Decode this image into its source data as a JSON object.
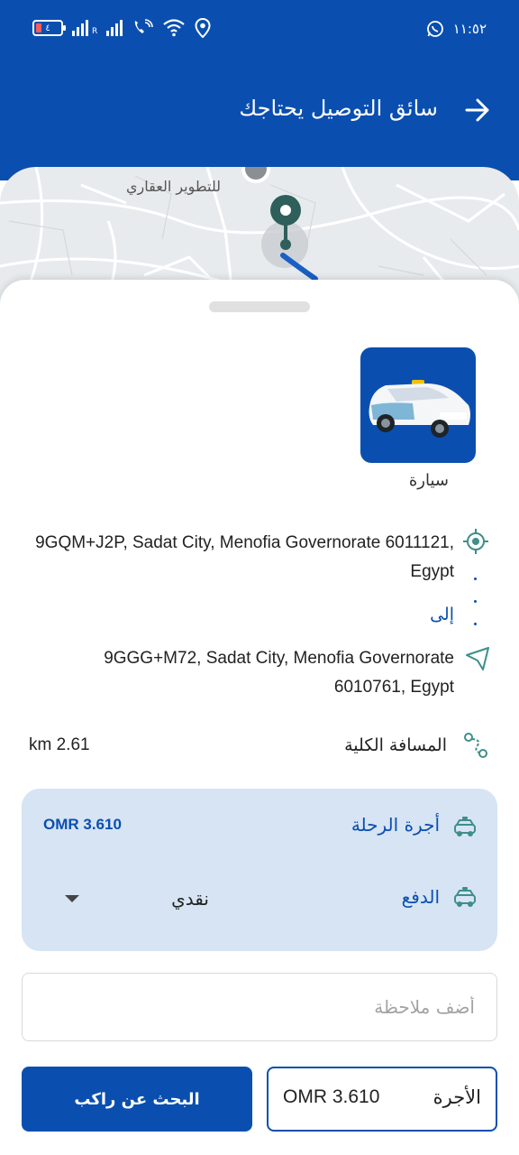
{
  "status_bar": {
    "battery_level": "٤",
    "signal_label": "R",
    "time": "١١:٥٢"
  },
  "header": {
    "title": "سائق التوصيل يحتاجك",
    "back_icon": "arrow-right-icon"
  },
  "map": {
    "label": "للتطوير العقاري"
  },
  "vehicle": {
    "label": "سيارة"
  },
  "route": {
    "from_address": "9GQM+J2P, Sadat City, Menofia Governorate 6011121, Egypt",
    "to_label": "إلى",
    "to_address": "9GGG+M72, Sadat City, Menofia Governorate 6010761, Egypt"
  },
  "distance": {
    "label": "المسافة الكلية",
    "value": "km 2.61"
  },
  "fare_card": {
    "fare_label": "أجرة الرحلة",
    "fare_value": "OMR 3.610",
    "payment_label": "الدفع",
    "payment_value": "نقدي"
  },
  "note": {
    "placeholder": "أضف ملاحظة"
  },
  "footer": {
    "search_button": "البحث عن راكب",
    "fare_label": "الأجرة",
    "fare_value": "OMR 3.610"
  },
  "colors": {
    "primary": "#0a4fb0",
    "card_bg": "#d6e4f3",
    "route_line": "#1a5fc4",
    "pin": "#2e5f5a"
  }
}
